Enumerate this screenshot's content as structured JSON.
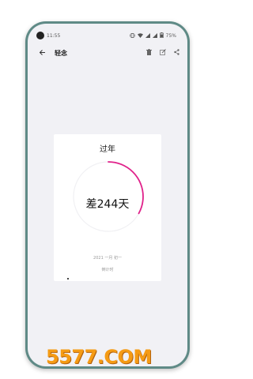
{
  "status": {
    "time": "11:55",
    "battery": "75%",
    "icons": [
      "vibrate-icon",
      "wifi-icon",
      "signal-icon",
      "battery-icon"
    ]
  },
  "appbar": {
    "title": "轻念",
    "icons": [
      "back-arrow-icon",
      "delete-icon",
      "edit-icon",
      "share-icon"
    ]
  },
  "card": {
    "title": "过年",
    "count": "差244天",
    "date": "2021 一月 初一",
    "label": "倒计时",
    "progress_fraction": 0.33,
    "accent_color": "#e0218a"
  },
  "watermark": "5577.COM"
}
